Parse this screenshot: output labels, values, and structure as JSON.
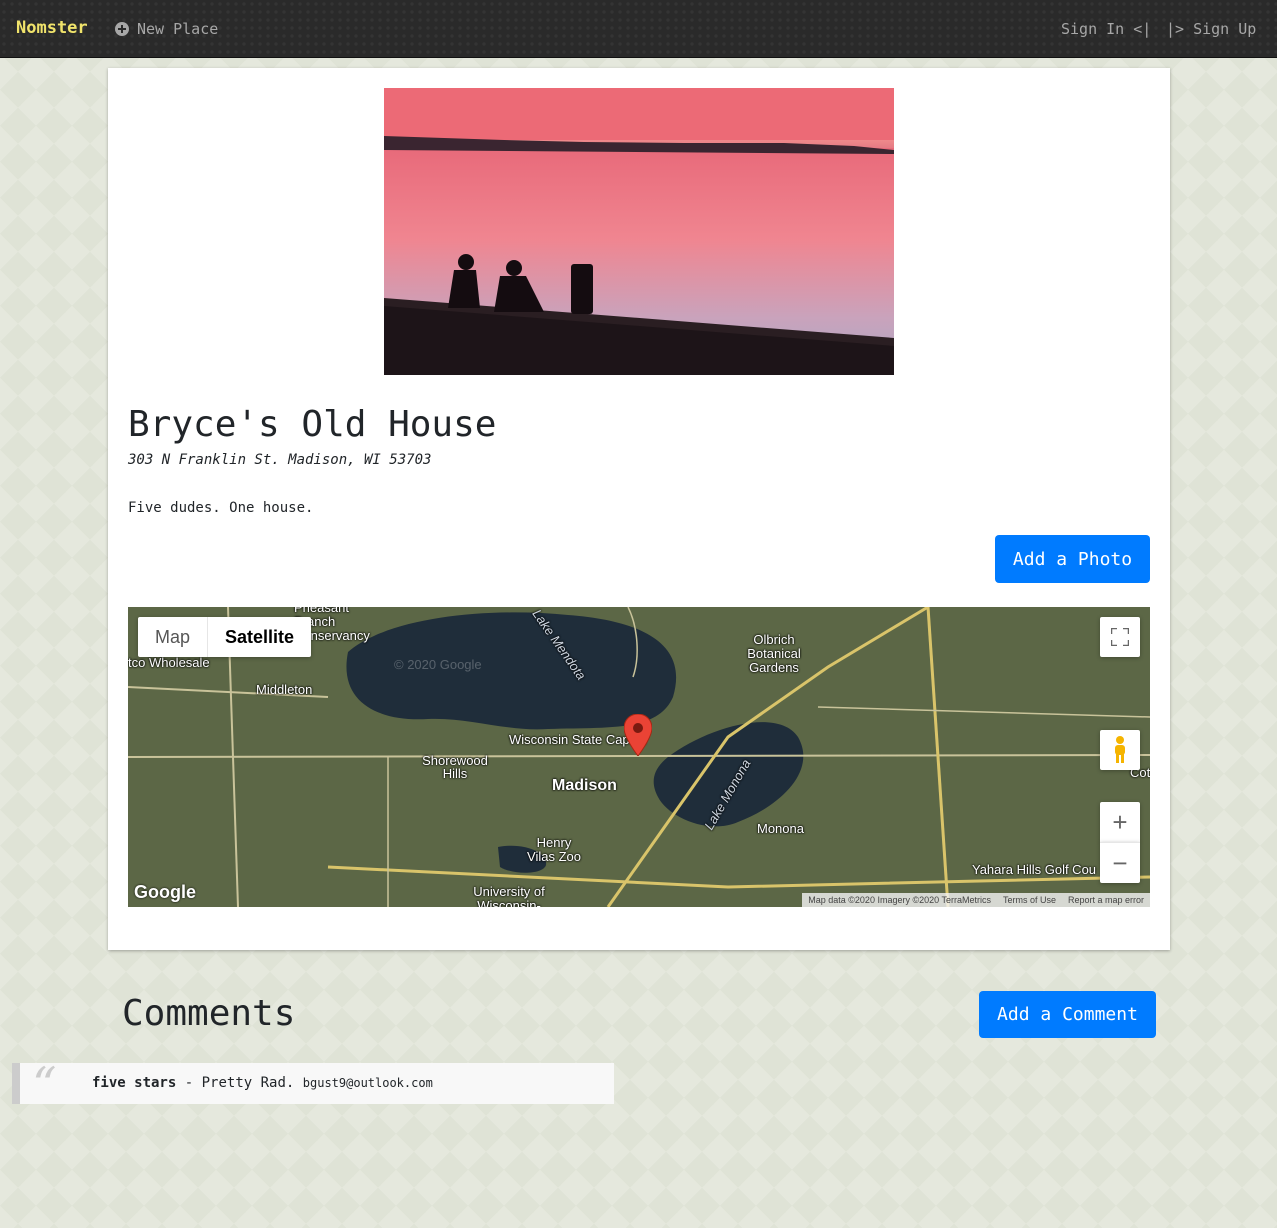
{
  "nav": {
    "brand": "Nomster",
    "new_place": "New Place",
    "sign_in": "Sign In <|",
    "sign_up": "|> Sign Up"
  },
  "place": {
    "name": "Bryce's Old House",
    "address": "303 N Franklin St. Madison, WI 53703",
    "description": "Five dudes. One house.",
    "add_photo_label": "Add a Photo"
  },
  "map": {
    "type_map": "Map",
    "type_satellite": "Satellite",
    "labels": {
      "costco": "tco Wholesale",
      "middleton": "Middleton",
      "pheasant": "Pheasant Branch Conservancy",
      "lake_mendota": "Lake Mendota",
      "watermark": "© 2020 Google",
      "olbrich": "Olbrich Botanical Gardens",
      "capitol": "Wisconsin State Capitol",
      "shorewood": "Shorewood Hills",
      "madison": "Madison",
      "lake_monona": "Lake Monona",
      "monona": "Monona",
      "henry_vilas": "Henry Vilas Zoo",
      "university": "University of Wisconsin-Madison",
      "yahara": "Yahara Hills Golf Cou",
      "cot": "Cot"
    },
    "google": "Google",
    "footer_data": "Map data ©2020 Imagery ©2020 TerraMetrics",
    "footer_terms": "Terms of Use",
    "footer_report": "Report a map error"
  },
  "comments": {
    "title": "Comments",
    "add_label": "Add a Comment",
    "items": [
      {
        "rating": "five stars",
        "separator": "-",
        "message": "Pretty Rad.",
        "author": "bgust9@outlook.com"
      }
    ]
  }
}
